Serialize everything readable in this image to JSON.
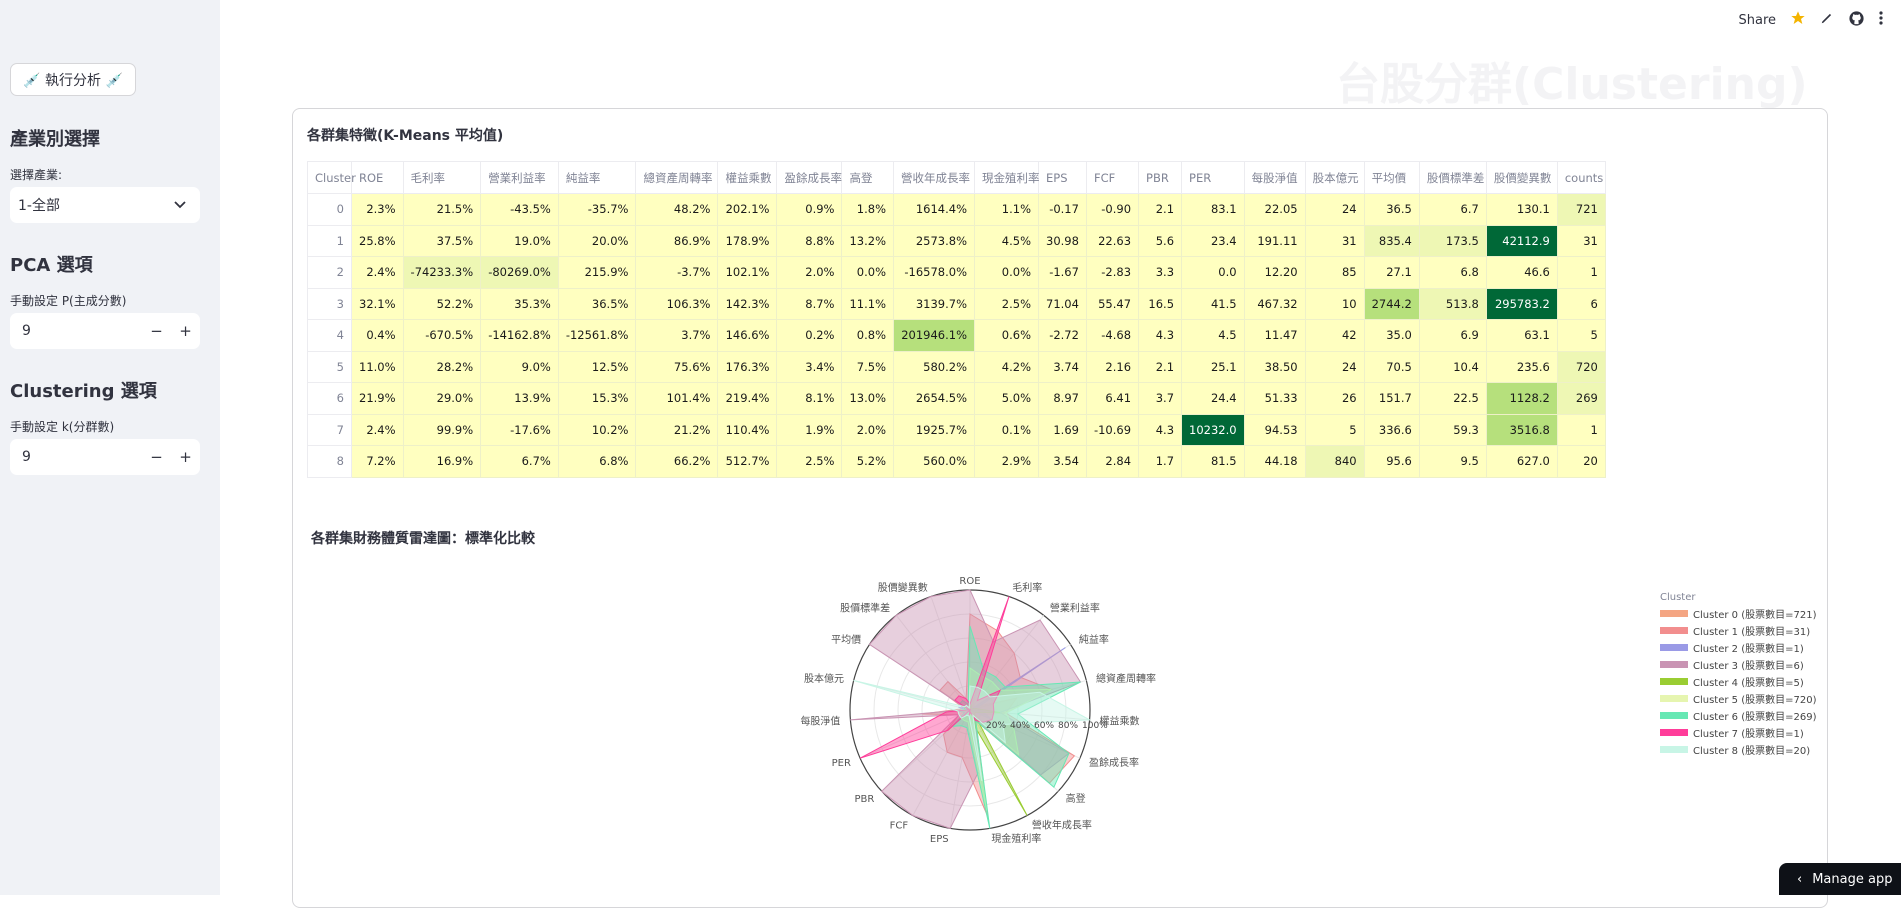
{
  "sidebar": {
    "run_button": "💉 執行分析 💉",
    "industry_header": "產業別選擇",
    "industry_label": "選擇產業:",
    "industry_value": "1-全部",
    "pca_header": "PCA 選項",
    "pca_label": "手動設定 P(主成分數)",
    "pca_value": "9",
    "cluster_header": "Clustering 選項",
    "cluster_label": "手動設定 k(分群數)",
    "cluster_value": "9"
  },
  "topbar": {
    "share": "Share"
  },
  "title": "台股分群(Clustering)",
  "table": {
    "title": "各群集特徵(K-Means 平均值)",
    "columns": [
      "Cluster",
      "ROE",
      "毛利率",
      "營業利益率",
      "純益率",
      "總資產周轉率",
      "權益乘數",
      "盈餘成長率",
      "高登",
      "營收年成長率",
      "現金殖利率",
      "EPS",
      "FCF",
      "PBR",
      "PER",
      "每股淨值",
      "股本億元",
      "平均價",
      "股價標準差",
      "股價變異數",
      "counts"
    ],
    "rows": [
      [
        "0",
        "2.3%",
        "21.5%",
        "-43.5%",
        "-35.7%",
        "48.2%",
        "202.1%",
        "0.9%",
        "1.8%",
        "1614.4%",
        "1.1%",
        "-0.17",
        "-0.90",
        "2.1",
        "83.1",
        "22.05",
        "24",
        "36.5",
        "6.7",
        "130.1",
        "721"
      ],
      [
        "1",
        "25.8%",
        "37.5%",
        "19.0%",
        "20.0%",
        "86.9%",
        "178.9%",
        "8.8%",
        "13.2%",
        "2573.8%",
        "4.5%",
        "30.98",
        "22.63",
        "5.6",
        "23.4",
        "191.11",
        "31",
        "835.4",
        "173.5",
        "42112.9",
        "31"
      ],
      [
        "2",
        "2.4%",
        "-74233.3%",
        "-80269.0%",
        "215.9%",
        "-3.7%",
        "102.1%",
        "2.0%",
        "0.0%",
        "-16578.0%",
        "0.0%",
        "-1.67",
        "-2.83",
        "3.3",
        "0.0",
        "12.20",
        "85",
        "27.1",
        "6.8",
        "46.6",
        "1"
      ],
      [
        "3",
        "32.1%",
        "52.2%",
        "35.3%",
        "36.5%",
        "106.3%",
        "142.3%",
        "8.7%",
        "11.1%",
        "3139.7%",
        "2.5%",
        "71.04",
        "55.47",
        "16.5",
        "41.5",
        "467.32",
        "10",
        "2744.2",
        "513.8",
        "295783.2",
        "6"
      ],
      [
        "4",
        "0.4%",
        "-670.5%",
        "-14162.8%",
        "-12561.8%",
        "3.7%",
        "146.6%",
        "0.2%",
        "0.8%",
        "201946.1%",
        "0.6%",
        "-2.72",
        "-4.68",
        "4.3",
        "4.5",
        "11.47",
        "42",
        "35.0",
        "6.9",
        "63.1",
        "5"
      ],
      [
        "5",
        "11.0%",
        "28.2%",
        "9.0%",
        "12.5%",
        "75.6%",
        "176.3%",
        "3.4%",
        "7.5%",
        "580.2%",
        "4.2%",
        "3.74",
        "2.16",
        "2.1",
        "25.1",
        "38.50",
        "24",
        "70.5",
        "10.4",
        "235.6",
        "720"
      ],
      [
        "6",
        "21.9%",
        "29.0%",
        "13.9%",
        "15.3%",
        "101.4%",
        "219.4%",
        "8.1%",
        "13.0%",
        "2654.5%",
        "5.0%",
        "8.97",
        "6.41",
        "3.7",
        "24.4",
        "51.33",
        "26",
        "151.7",
        "22.5",
        "1128.2",
        "269"
      ],
      [
        "7",
        "2.4%",
        "99.9%",
        "-17.6%",
        "10.2%",
        "21.2%",
        "110.4%",
        "1.9%",
        "2.0%",
        "1925.7%",
        "0.1%",
        "1.69",
        "-10.69",
        "4.3",
        "10232.0",
        "94.53",
        "5",
        "336.6",
        "59.3",
        "3516.8",
        "1"
      ],
      [
        "8",
        "7.2%",
        "16.9%",
        "6.7%",
        "6.8%",
        "66.2%",
        "512.7%",
        "2.5%",
        "5.2%",
        "560.0%",
        "2.9%",
        "3.54",
        "2.84",
        "1.7",
        "81.5",
        "44.18",
        "840",
        "95.6",
        "9.5",
        "627.0",
        "20"
      ]
    ],
    "highlights": {
      "dark": [
        "1-19",
        "3-19",
        "7-14"
      ],
      "mid": [
        "3-17",
        "7-19",
        "4-9",
        "6-19"
      ],
      "light": [
        "1-17",
        "3-18",
        "8-16",
        "1-18",
        "2-2",
        "2-3",
        "0-20",
        "5-20",
        "6-20"
      ]
    }
  },
  "radar": {
    "title": "各群集財務體質雷達圖：標準化比較",
    "axes": [
      "ROE",
      "毛利率",
      "營業利益率",
      "純益率",
      "總資產周轉率",
      "權益乘數",
      "盈餘成長率",
      "高登",
      "營收年成長率",
      "現金殖利率",
      "EPS",
      "FCF",
      "PBR",
      "PER",
      "每股淨值",
      "股本億元",
      "平均價",
      "股價標準差",
      "股價變異數"
    ],
    "ticks": [
      "20%",
      "40%",
      "60%",
      "80%",
      "100%"
    ],
    "legend_title": "Cluster",
    "series": [
      {
        "name": "Cluster 0 (股票數目=721)",
        "color": "#f4a582"
      },
      {
        "name": "Cluster 1 (股票數目=31)",
        "color": "#f28e8e"
      },
      {
        "name": "Cluster 2 (股票數目=1)",
        "color": "#9a9ae6"
      },
      {
        "name": "Cluster 3 (股票數目=6)",
        "color": "#c994b3"
      },
      {
        "name": "Cluster 4 (股票數目=5)",
        "color": "#9acd32"
      },
      {
        "name": "Cluster 5 (股票數目=720)",
        "color": "#e6f5b0"
      },
      {
        "name": "Cluster 6 (股票數目=269)",
        "color": "#66e8b4"
      },
      {
        "name": "Cluster 7 (股票數目=1)",
        "color": "#ff3d9a"
      },
      {
        "name": "Cluster 8 (股票數目=20)",
        "color": "#c8f5e6"
      }
    ]
  },
  "manage_app": "Manage app"
}
